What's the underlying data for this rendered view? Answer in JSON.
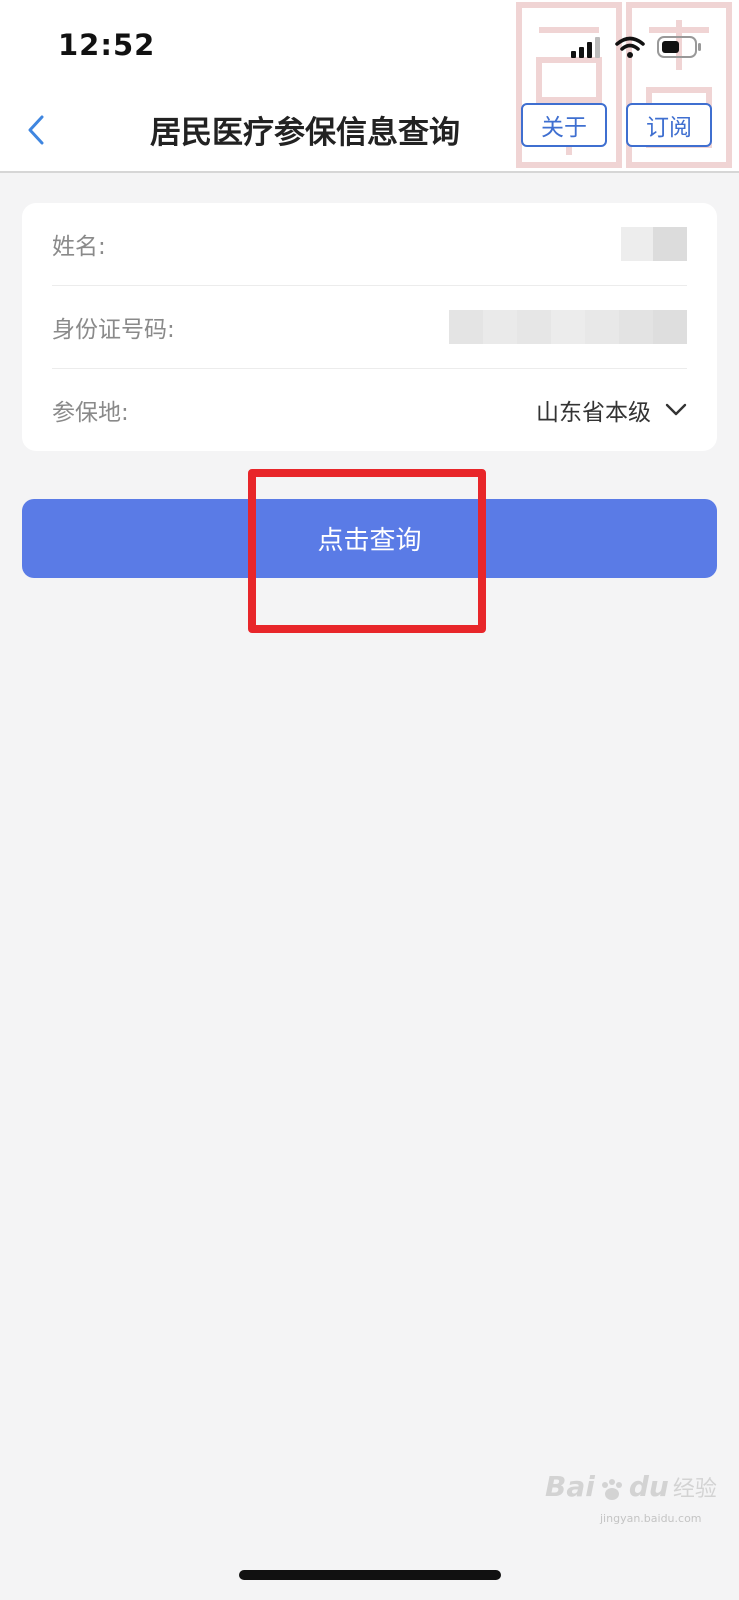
{
  "status_bar": {
    "time": "12:52"
  },
  "nav": {
    "title": "居民医疗参保信息查询",
    "about_label": "关于",
    "subscribe_label": "订阅"
  },
  "form": {
    "name_label": "姓名:",
    "id_label": "身份证号码:",
    "region_label": "参保地:",
    "region_value": "山东省本级"
  },
  "actions": {
    "query_label": "点击查询"
  },
  "watermark": {
    "brand": "Bai",
    "brand2": "du",
    "sub": "经验",
    "url": "jingyan.baidu.com"
  },
  "colors": {
    "accent": "#5a7be6",
    "nav_button": "#3f6fd0",
    "highlight": "#e8262a",
    "background": "#f4f4f5"
  }
}
